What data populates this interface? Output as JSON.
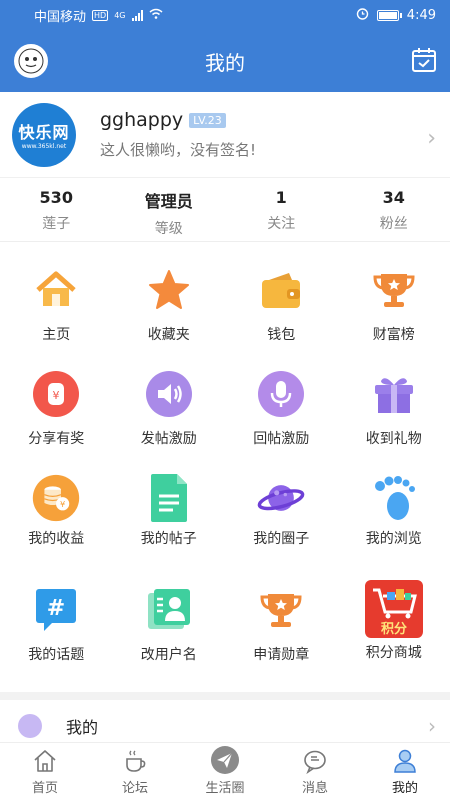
{
  "status_bar": {
    "carrier": "中国移动",
    "hd": "HD",
    "network": "4G",
    "time": "4:49"
  },
  "header": {
    "title": "我的"
  },
  "profile": {
    "logo_title": "快乐网",
    "logo_sub": "www.365kl.net",
    "username": "gghappy",
    "level": "LV.23",
    "signature": "这人很懒哟，没有签名!"
  },
  "stats": [
    {
      "value": "530",
      "label": "莲子"
    },
    {
      "value": "管理员",
      "label": "等级"
    },
    {
      "value": "1",
      "label": "关注"
    },
    {
      "value": "34",
      "label": "粉丝"
    }
  ],
  "grid": [
    {
      "label": "主页",
      "icon": "home-icon"
    },
    {
      "label": "收藏夹",
      "icon": "star-icon"
    },
    {
      "label": "钱包",
      "icon": "wallet-icon"
    },
    {
      "label": "财富榜",
      "icon": "trophy-icon"
    },
    {
      "label": "分享有奖",
      "icon": "share-reward-icon"
    },
    {
      "label": "发帖激励",
      "icon": "speaker-icon"
    },
    {
      "label": "回帖激励",
      "icon": "microphone-icon"
    },
    {
      "label": "收到礼物",
      "icon": "gift-icon"
    },
    {
      "label": "我的收益",
      "icon": "coins-icon"
    },
    {
      "label": "我的帖子",
      "icon": "document-icon"
    },
    {
      "label": "我的圈子",
      "icon": "planet-icon"
    },
    {
      "label": "我的浏览",
      "icon": "footprint-icon"
    },
    {
      "label": "我的话题",
      "icon": "hashtag-icon"
    },
    {
      "label": "改用户名",
      "icon": "contact-card-icon"
    },
    {
      "label": "申请勋章",
      "icon": "medal-icon"
    },
    {
      "label": "积分商城",
      "icon": "points-mall-icon",
      "badge": "积分"
    }
  ],
  "more": {
    "label": "我的"
  },
  "nav": [
    {
      "label": "首页",
      "icon": "home-outline-icon"
    },
    {
      "label": "论坛",
      "icon": "coffee-cup-icon"
    },
    {
      "label": "生活圈",
      "icon": "paper-plane-icon"
    },
    {
      "label": "消息",
      "icon": "chat-bubble-icon"
    },
    {
      "label": "我的",
      "icon": "person-icon"
    }
  ],
  "colors": {
    "primary": "#3d7fd6",
    "accent_orange": "#f6a43a",
    "accent_purple": "#a98ae8"
  }
}
